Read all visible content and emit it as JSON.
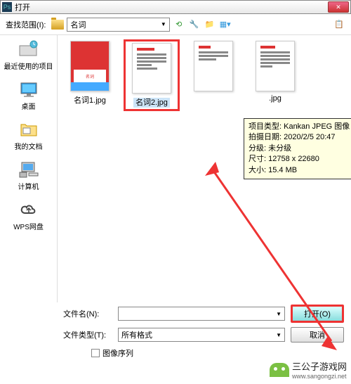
{
  "titlebar": {
    "title": "打开",
    "close": "✕"
  },
  "toolbar": {
    "range_label": "查找范围(I):",
    "current_folder": "名词",
    "dropdown_arrow": "▼"
  },
  "sidebar": {
    "recent": "最近使用的项目",
    "desktop": "桌面",
    "documents": "我的文档",
    "computer": "计算机",
    "wps": "WPS网盘"
  },
  "files": [
    {
      "name": "名词1.jpg",
      "thumb_text": "名词"
    },
    {
      "name": "名词2.jpg"
    },
    {
      "name": ""
    },
    {
      "name": ".jpg"
    }
  ],
  "tooltip": {
    "l1": "项目类型: Kankan JPEG 图像",
    "l2": "拍摄日期: 2020/2/5 20:47",
    "l3": "分级: 未分级",
    "l4": "尺寸: 12758 x 22680",
    "l5": "大小: 15.4 MB"
  },
  "bottom": {
    "filename_label": "文件名(N):",
    "filetype_label": "文件类型(T):",
    "filetype_value": "所有格式",
    "open_btn": "打开(O)",
    "cancel_btn": "取消",
    "seq_label": "图像序列",
    "dropdown_arrow": "▼"
  },
  "watermark": {
    "name": "三公子游戏网",
    "url": "www.sangongzi.net"
  }
}
